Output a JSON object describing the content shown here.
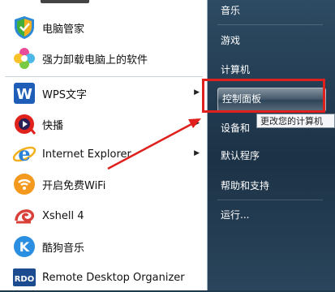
{
  "left_menu": {
    "items": [
      {
        "label": "电脑管家",
        "icon": "shield-icon"
      },
      {
        "label": "强力卸载电脑上的软件",
        "icon": "flower-icon"
      },
      {
        "label": "WPS文字",
        "icon": "wps-icon"
      },
      {
        "label": "快播",
        "icon": "qvod-icon"
      },
      {
        "label": "Internet Explorer",
        "icon": "ie-icon"
      },
      {
        "label": "开启免费WiFi",
        "icon": "wifi-icon"
      },
      {
        "label": "Xshell 4",
        "icon": "xshell-icon"
      },
      {
        "label": "酷狗音乐",
        "icon": "kugou-icon"
      },
      {
        "label": "Remote Desktop Organizer",
        "icon": "rdo-icon"
      }
    ],
    "submenu_arrow": "▶"
  },
  "right_menu": {
    "items": [
      "音乐",
      "游戏",
      "计算机",
      "控制面板",
      "设备和",
      "默认程序",
      "帮助和支持",
      "运行..."
    ],
    "highlighted": "控制面板"
  },
  "tooltip": "更改您的计算机",
  "icons": {
    "wps_letter": "W",
    "ie_letter": "e",
    "kugou_letter": "K",
    "rdo_letter": "RDO"
  },
  "colors": {
    "annotation_red": "#e0201d"
  }
}
